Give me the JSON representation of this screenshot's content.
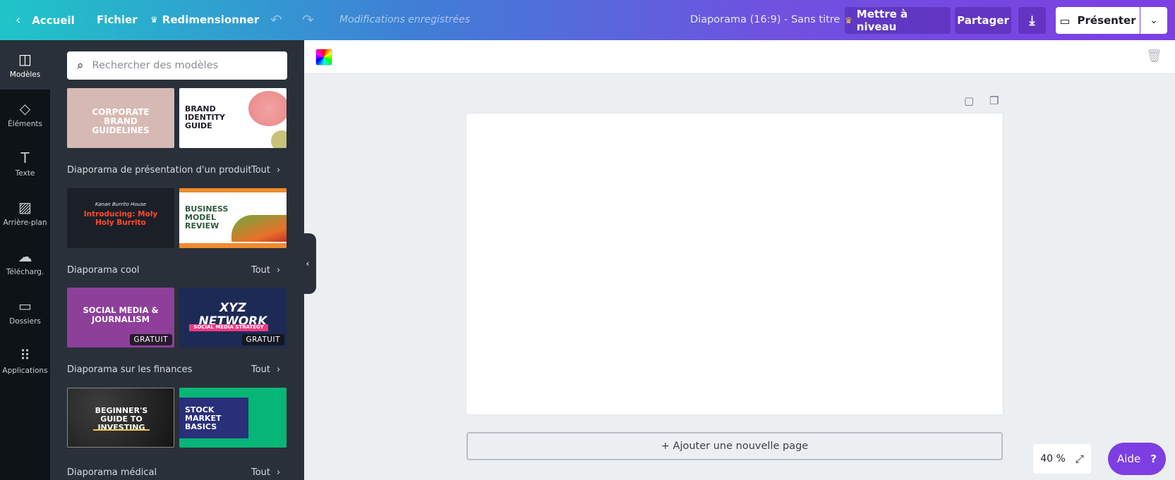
{
  "topbar": {
    "back_label": "Accueil",
    "file_label": "Fichier",
    "resize_label": "Redimensionner",
    "saved_status": "Modifications enregistrées",
    "doc_title": "Diaporama (16:9) - Sans titre",
    "upgrade_label": "Mettre à niveau",
    "share_label": "Partager",
    "present_label": "Présenter"
  },
  "rail": {
    "items": [
      {
        "label": "Modèles",
        "icon": "templates-icon",
        "active": true
      },
      {
        "label": "Éléments",
        "icon": "elements-icon"
      },
      {
        "label": "Texte",
        "icon": "text-icon"
      },
      {
        "label": "Arrière-plan",
        "icon": "background-icon"
      },
      {
        "label": "Télécharg.",
        "icon": "upload-icon"
      },
      {
        "label": "Dossiers",
        "icon": "folder-icon"
      },
      {
        "label": "Applications",
        "icon": "apps-icon"
      }
    ]
  },
  "panel": {
    "search_placeholder": "Rechercher des modèles",
    "sections": [
      {
        "title": "Diaporama de présentation d'un produit",
        "all": "Tout"
      },
      {
        "title": "Diaporama cool",
        "all": "Tout"
      },
      {
        "title": "Diaporama sur les finances",
        "all": "Tout"
      },
      {
        "title": "Diaporama médical",
        "all": "Tout"
      }
    ],
    "thumbs": {
      "t1": "CORPORATE BRAND GUIDELINES",
      "t2": "BRAND IDENTITY GUIDE",
      "t3a": "Kanan Burrito House",
      "t3b": "Introducing: Moly Holy Burrito",
      "t4": "BUSINESS MODEL REVIEW",
      "t5": "SOCIAL MEDIA & JOURNALISM",
      "t6a": "XYZ NETWORK",
      "t6b": "SOCIAL MEDIA STRATEGY",
      "t7": "BEGINNER'S GUIDE TO INVESTING",
      "t8": "STOCK MARKET BASICS"
    },
    "badge": "GRATUIT"
  },
  "editor": {
    "add_page_label": "+ Ajouter une nouvelle page",
    "zoom_label": "40 %",
    "help_label": "Aide"
  },
  "colors": {
    "accent": "#7d3fe2",
    "panel_bg": "#293039",
    "rail_bg": "#0e1318"
  }
}
